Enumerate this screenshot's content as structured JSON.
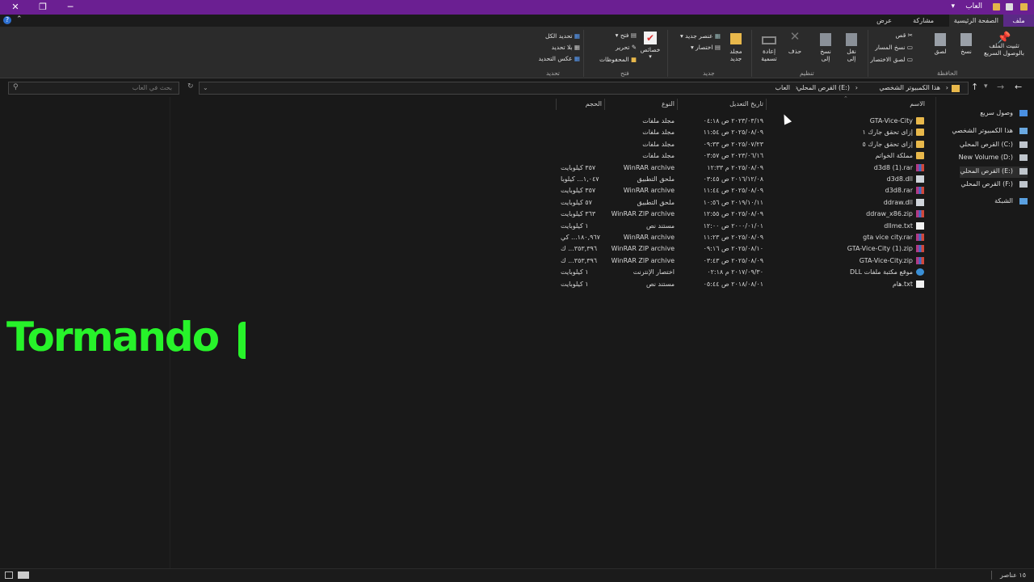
{
  "window": {
    "title": "العاب"
  },
  "ribbon_tabs": [
    {
      "label": "ملف"
    },
    {
      "label": "الصفحة الرئيسية"
    },
    {
      "label": "مشاركة"
    },
    {
      "label": "عرض"
    }
  ],
  "ribbon": {
    "clipboard": {
      "pin": "تثبيت الملف\nبالوصول السريع",
      "copy": "نسخ",
      "paste": "لصق",
      "cut": "قص",
      "copy_path": "نسخ المسار",
      "paste_shortcut": "لصق الاختصار",
      "group": "الحافظة"
    },
    "organize": {
      "move_to": "نقل\nإلى",
      "copy_to": "نسخ\nإلى",
      "delete": "حذف",
      "rename": "إعادة\nتسمية",
      "group": "تنظيم"
    },
    "new": {
      "new_folder": "مجلد\nجديد",
      "new_item": "عنصر جديد",
      "easy_access": "اختصار",
      "group": "جديد"
    },
    "open": {
      "properties": "خصائص",
      "open": "فتح",
      "edit": "تحرير",
      "history": "المحفوظات",
      "group": "فتح"
    },
    "select": {
      "select_all": "تحديد الكل",
      "select_none": "بلا تحديد",
      "invert": "عكس التحديد",
      "group": "تحديد"
    }
  },
  "address": {
    "crumbs": [
      "هذا الكمبيوتر الشخصي",
      "القرص المحلي (E:)",
      "العاب"
    ],
    "search_placeholder": "بحث في العاب"
  },
  "columns": {
    "name": "الاسم",
    "date": "تاريخ التعديل",
    "type": "النوع",
    "size": "الحجم"
  },
  "files": [
    {
      "name": "GTA-Vice-City",
      "date": "٢٠٢٣/٠٣/١٩ ص ٠٤:١٨",
      "type": "مجلد ملفات",
      "size": "",
      "icon": "folder-icon"
    },
    {
      "name": "إزاى تحقق جارك ١",
      "date": "٢٠٢٥/٠٨/٠٩ ص ١١:٥٤",
      "type": "مجلد ملفات",
      "size": "",
      "icon": "folder-icon"
    },
    {
      "name": "إزاى تحقق جارك ٥",
      "date": "٢٠٢٥/٠٧/٢٣ ص ٠٩:٣٣",
      "type": "مجلد ملفات",
      "size": "",
      "icon": "folder-icon"
    },
    {
      "name": "مملكة الخواتم",
      "date": "٢٠٢٣/٠٦/١٦ ص ٠٣:٥٧",
      "type": "مجلد ملفات",
      "size": "",
      "icon": "folder-icon"
    },
    {
      "name": "d3d8 (1).rar",
      "date": "٢٠٢٥/٠٨/٠٩ م ١٢:٣٣",
      "type": "WinRAR archive",
      "size": "٣٥٧ كيلوبايت",
      "icon": "rar-icon"
    },
    {
      "name": "d3d8.dll",
      "date": "٢٠١٦/١٢/٠٨ ص ٠٣:٤٥",
      "type": "ملحق التطبيق",
      "size": "١,٠٤٧... كيلوبا",
      "icon": "dll-icon"
    },
    {
      "name": "d3d8.rar",
      "date": "٢٠٢٥/٠٨/٠٩ ص ١١:٤٤",
      "type": "WinRAR archive",
      "size": "٣٥٧ كيلوبايت",
      "icon": "rar-icon"
    },
    {
      "name": "ddraw.dll",
      "date": "٢٠١٩/١٠/١١ ص ١٠:٥٦",
      "type": "ملحق التطبيق",
      "size": "٥٧ كيلوبايت",
      "icon": "dll-icon"
    },
    {
      "name": "ddraw_x86.zip",
      "date": "٢٠٢٥/٠٨/٠٩ ص ١٢:٥٥",
      "type": "WinRAR ZIP archive",
      "size": "٣٦٣ كيلوبايت",
      "icon": "rar-icon"
    },
    {
      "name": "dllme.txt",
      "date": "٢٠٠٠/٠١/٠١ ص ١٢:٠٠",
      "type": "مستند نص",
      "size": "١ كيلوبايت",
      "icon": "txt-icon"
    },
    {
      "name": "gta vice city.rar",
      "date": "٢٠٢٥/٠٨/٠٩ ص ١١:٢٣",
      "type": "WinRAR archive",
      "size": "١٨٠,٩٦٧... كي",
      "icon": "rar-icon"
    },
    {
      "name": "GTA-Vice-City (1).zip",
      "date": "٢٠٢٥/٠٨/١٠ ص ٠٩:١٦",
      "type": "WinRAR ZIP archive",
      "size": "٣٥٣,٣٩٦... ك",
      "icon": "rar-icon"
    },
    {
      "name": "GTA-Vice-City.zip",
      "date": "٢٠٢٥/٠٨/٠٩ ص ٠٣:٤٣",
      "type": "WinRAR ZIP archive",
      "size": "٣٥٣,٣٩٦... ك",
      "icon": "rar-icon"
    },
    {
      "name": "DLL موقع مكتبة ملفات",
      "date": "٢٠١٧/٠٩/٣٠ م ٠٢:١٨",
      "type": "اختصار الإنترنت",
      "size": "١ كيلوبايت",
      "icon": "url-icon"
    },
    {
      "name": "هام.txt",
      "date": "٢٠١٨/٠٨/٠١ ص ٠٥:٤٤",
      "type": "مستند نص",
      "size": "١ كيلوبايت",
      "icon": "txt-icon"
    }
  ],
  "nav": [
    {
      "label": "وصول سريع",
      "icon": "star-icon"
    },
    {
      "label": "هذا الكمبيوتر الشخصي",
      "icon": "computer-icon"
    },
    {
      "label": "القرص المحلي (C:)",
      "icon": "drive-icon"
    },
    {
      "label": "New Volume (D:)",
      "icon": "drive-icon"
    },
    {
      "label": "القرص المحلي (E:)",
      "icon": "drive-icon"
    },
    {
      "label": "القرص المحلي (F:)",
      "icon": "drive-icon"
    },
    {
      "label": "الشبكة",
      "icon": "network-icon"
    }
  ],
  "status": {
    "count": "١٥ عناصر"
  },
  "overlay": {
    "text": "Tormando"
  }
}
